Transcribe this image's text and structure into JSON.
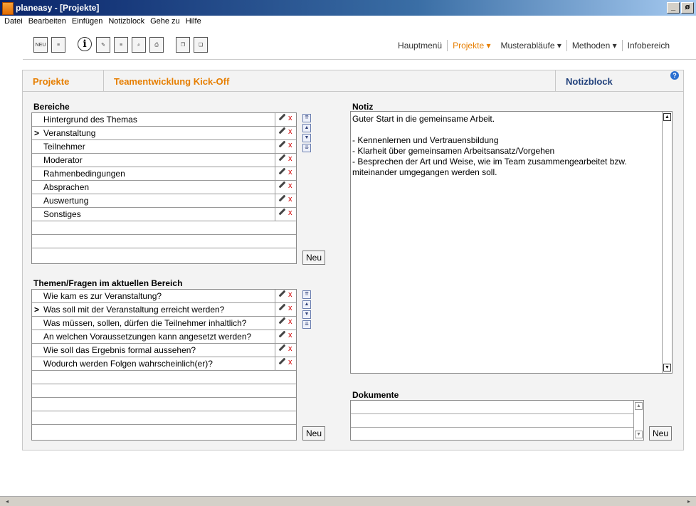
{
  "window": {
    "title": "planeasy - [Projekte]",
    "min": "_",
    "max": "ø",
    "close": "x"
  },
  "menu": [
    "Datei",
    "Bearbeiten",
    "Einfügen",
    "Notizblock",
    "Gehe zu",
    "Hilfe"
  ],
  "toolbar": {
    "new_label": "NEU",
    "info_label": "i"
  },
  "nav": {
    "main": "Hauptmenü",
    "projects": "Projekte ▾",
    "workflows": "Musterabläufe ▾",
    "methods": "Methoden ▾",
    "info": "Infobereich"
  },
  "tabs": {
    "projects": "Projekte",
    "project_name": "Teamentwicklung Kick-Off",
    "notepad": "Notizblock",
    "help": "?"
  },
  "areas": {
    "heading": "Bereiche",
    "items": [
      "Hintergrund des Themas",
      "Veranstaltung",
      "Teilnehmer",
      "Moderator",
      "Rahmenbedingungen",
      "Absprachen",
      "Auswertung",
      "Sonstiges"
    ],
    "selected_marker": ">",
    "new_button": "Neu"
  },
  "topics": {
    "heading": "Themen/Fragen im aktuellen Bereich",
    "items": [
      "Wie kam es zur Veranstaltung?",
      "Was soll mit der Veranstaltung erreicht werden?",
      "Was müssen, sollen, dürfen die Teilnehmer inhaltlich?",
      "An welchen Voraussetzungen kann angesetzt werden?",
      "Wie soll das Ergebnis formal aussehen?",
      "Wodurch werden Folgen wahrscheinlich(er)?"
    ],
    "selected_marker": ">",
    "new_button": "Neu"
  },
  "note": {
    "heading": "Notiz",
    "lines": [
      "Guter Start in die gemeinsame Arbeit.",
      "",
      "- Kennenlernen und Vertrauensbildung",
      "- Klarheit über gemeinsamen Arbeitsansatz/Vorgehen",
      "- Besprechen der Art und Weise, wie im Team zusammengearbeitet bzw.",
      "miteinander umgegangen werden soll."
    ]
  },
  "documents": {
    "heading": "Dokumente",
    "new_button": "Neu"
  },
  "icons": {
    "delete": "x",
    "up_top": "⇈",
    "up": "▲",
    "down": "▼",
    "down_bottom": "⇊"
  }
}
